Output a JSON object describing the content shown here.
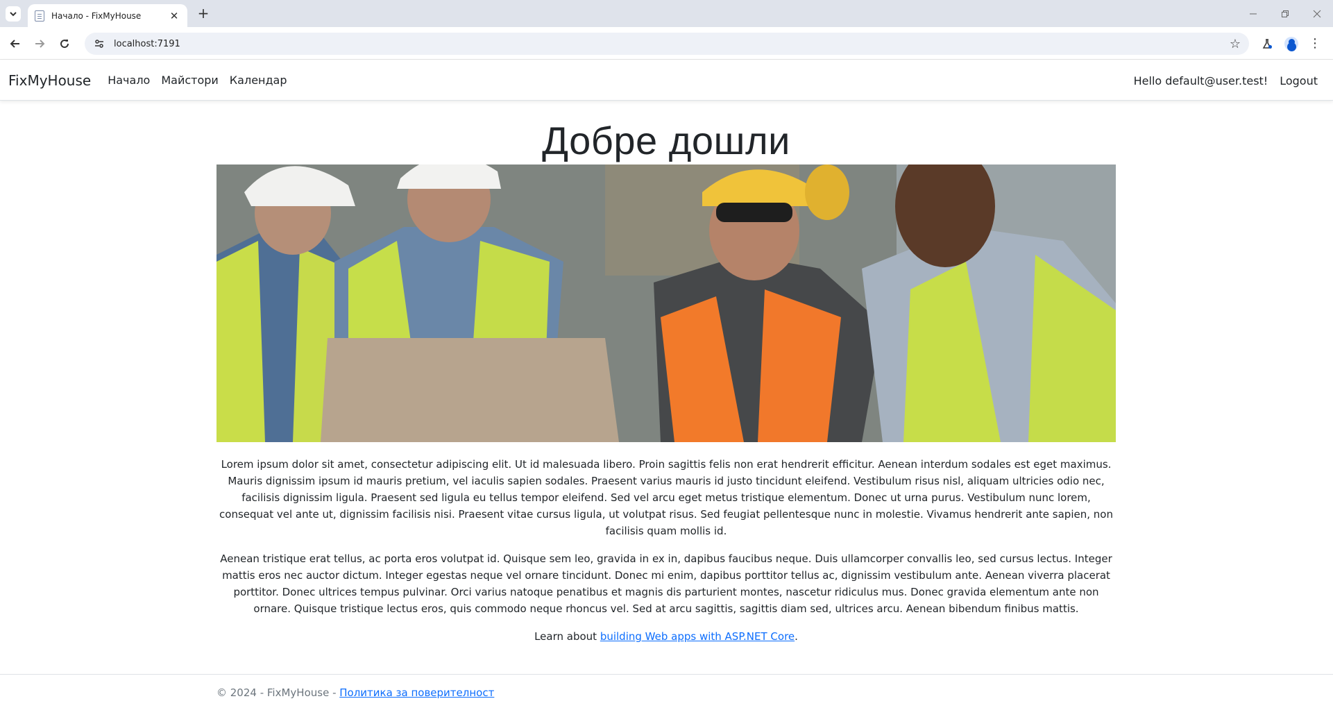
{
  "browser": {
    "tab_title": "Начало - FixMyHouse",
    "url": "localhost:7191"
  },
  "navbar": {
    "brand": "FixMyHouse",
    "links": [
      "Начало",
      "Майстори",
      "Календар"
    ],
    "greeting": "Hello default@user.test!",
    "logout": "Logout"
  },
  "main": {
    "heading": "Добре дошли",
    "hero_alt": "construction workers in hard hats and safety vests looking at a laptop",
    "paragraphs": [
      "Lorem ipsum dolor sit amet, consectetur adipiscing elit. Ut id malesuada libero. Proin sagittis felis non erat hendrerit efficitur. Aenean interdum sodales est eget maximus. Mauris dignissim ipsum id mauris pretium, vel iaculis sapien sodales. Praesent varius mauris id justo tincidunt eleifend. Vestibulum risus nisl, aliquam ultricies odio nec, facilisis dignissim ligula. Praesent sed ligula eu tellus tempor eleifend. Sed vel arcu eget metus tristique elementum. Donec ut urna purus. Vestibulum nunc lorem, consequat vel ante ut, dignissim facilisis nisi. Praesent vitae cursus ligula, ut volutpat risus. Sed feugiat pellentesque nunc in molestie. Vivamus hendrerit ante sapien, non facilisis quam mollis id.",
      "Aenean tristique erat tellus, ac porta eros volutpat id. Quisque sem leo, gravida in ex in, dapibus faucibus neque. Duis ullamcorper convallis leo, sed cursus lectus. Integer mattis eros nec auctor dictum. Integer egestas neque vel ornare tincidunt. Donec mi enim, dapibus porttitor tellus ac, dignissim vestibulum ante. Aenean viverra placerat porttitor. Donec ultrices tempus pulvinar. Orci varius natoque penatibus et magnis dis parturient montes, nascetur ridiculus mus. Donec gravida elementum ante non ornare. Quisque tristique lectus eros, quis commodo neque rhoncus vel. Sed at arcu sagittis, sagittis diam sed, ultrices arcu. Aenean bibendum finibus mattis."
    ],
    "learn_prefix": "Learn about ",
    "learn_link": "building Web apps with ASP.NET Core",
    "learn_suffix": "."
  },
  "footer": {
    "copyright": "© 2024 - FixMyHouse - ",
    "privacy_link": "Политика за поверителност"
  },
  "colors": {
    "link": "#0d6efd",
    "text": "#212529",
    "muted": "#6c757d",
    "tabstrip": "#dfe3eb"
  }
}
